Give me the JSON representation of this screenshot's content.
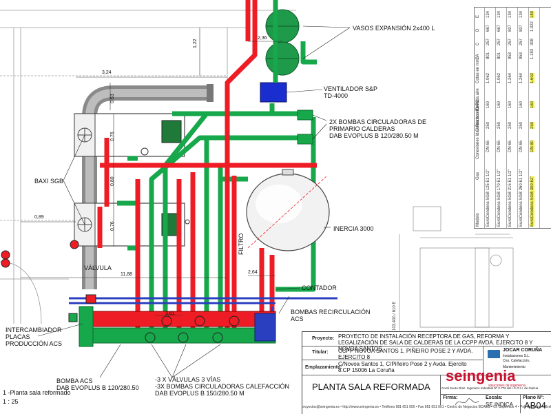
{
  "labels": {
    "vasos": "VASOS EXPANSIÓN 2x400 L",
    "ventilador_1": "VENTILADOR S&P",
    "ventilador_2": "TD-4000",
    "bombas_prim_1": "2X BOMBAS CIRCULADORAS DE",
    "bombas_prim_2": "PRIMARIO CALDERAS",
    "bombas_prim_3": "DAB EVOPLUS B 120/280.50 M",
    "baxi": "BAXI SGB",
    "inercia": "INERCIA 3000",
    "valvula": "VÁLVULA",
    "filtro": "FILTRO",
    "contador": "CONTADOR",
    "bombas_rec_1": "BOMBAS RECIRCULACIÓN",
    "bombas_rec_2": "ACS",
    "intercambiador_1": "INTERCAMBIADOR",
    "intercambiador_2": "PLACAS",
    "intercambiador_3": "PRODUCCIÓN ACS",
    "bomba_acs_1": "BOMBA ACS",
    "bomba_acs_2": "DAB EVOPLUS B 120/280.50",
    "valvulas_1": "-3 X VÁLVULAS 3 VÍAS",
    "valvulas_2": "-3X BOMBAS CIRCULADORAS CALEFACCIÓN",
    "valvulas_3": "DAB EVOPLUS B 150/280.50 M",
    "plan_name": "1 -Planta sala reformado",
    "plan_scale": "1 : 25"
  },
  "dimensions": {
    "d236": "2,36",
    "d122": "1,22",
    "d324": "3,24",
    "d063": "0,63",
    "d076a": "0,76",
    "d080": "0,80",
    "d076b": "0,76",
    "d089": "0,89",
    "d1188": "11,88",
    "d264": "2,64",
    "d361": "3,61"
  },
  "side": {
    "dim_vertical": "103.400 / 610 E",
    "table_headers": [
      "Modelo",
      "Gas",
      "Conexiones Ida / Retorno IC-RC",
      "Salida humos F",
      "Entrada aire",
      "Cotas en mm. A",
      "B",
      "C",
      "D",
      "E"
    ],
    "table_rows": [
      [
        "EuroCondens SGB 125 E",
        "1 1/2\"",
        "DN 65",
        "250",
        "160",
        "1.062",
        "801",
        "257",
        "667",
        "134"
      ],
      [
        "EuroCondens SGB 170 E",
        "1 1/2\"",
        "DN 65",
        "250",
        "160",
        "1.062",
        "801",
        "257",
        "667",
        "134"
      ],
      [
        "EuroCondens SGB 215 E",
        "1 1/2\"",
        "DN 65",
        "250",
        "160",
        "1.264",
        "953",
        "257",
        "807",
        "134"
      ],
      [
        "EuroCondens SGB 260 E",
        "1 1/2\"",
        "DN 65",
        "250",
        "160",
        "1.264",
        "953",
        "257",
        "807",
        "134"
      ],
      [
        "EuroCondens SGB 300 E",
        "2\"",
        "DN 80",
        "250",
        "160",
        "1.602",
        "1.183",
        "308",
        "1.022",
        "180"
      ]
    ]
  },
  "title_block": {
    "proyecto_k": "Proyecto:",
    "proyecto_v": "PROYECTO DE INSTALACIÓN RECEPTORA DE GAS, REFORMA Y LEGALIZACIÓN DE SALA DE CALDERAS DE LA CCPP AVDA. EJERCITO 8 Y NOVOA SANTOS",
    "titular_k": "Titular:",
    "titular_v": "CCPP NOVOA SANTOS 1, PIÑEIRO POSE 2 Y AVDA. EJERCITO 8",
    "emplazamiento_k": "Emplazamiento:",
    "emplazamiento_v": "C/Novoa Santos 1, C/Piñeiro Pose 2 y Avda. Ejercito 8.CP 15006 La Coruña",
    "company_1": "JOCAR CORUÑA",
    "company_2": "Instalaciones S.L.",
    "company_3": "Cno. Calefacción, Mantenimiento",
    "brand": "seingenia",
    "brand_sub": "soluciones de ingeniería",
    "brand_note": "Coral Souto Díaz. Ingeniero Industrial Nº 2.776 del I.C.O.I.I. de Galicia",
    "sheet_title": "PLANTA SALA REFORMADA",
    "firma_k": "Firma:",
    "escala_k": "Escala:",
    "escala_v": "SE INDICA",
    "plano_k": "Plano Nº:",
    "plano_v": "AB04",
    "footer": "proyectos@seingenia.es  •  http://www.seingenia.es  •  Teléfono 981 651 000  •  Fax 981 651 001  •  Centro de Negocios BCAES  •  Cl. Copérnico 4  •  Pol. Industrial A Grela  •  C.P. 15008  •  La Coruña"
  },
  "colors": {
    "red_pipe": "#ee1c24",
    "green_pipe": "#16a84a",
    "blue_pipe": "#2a3fbf",
    "flue_gray": "#8a8a8a",
    "tank_green": "#1f9a4a",
    "highlight": "#f5f23a"
  }
}
